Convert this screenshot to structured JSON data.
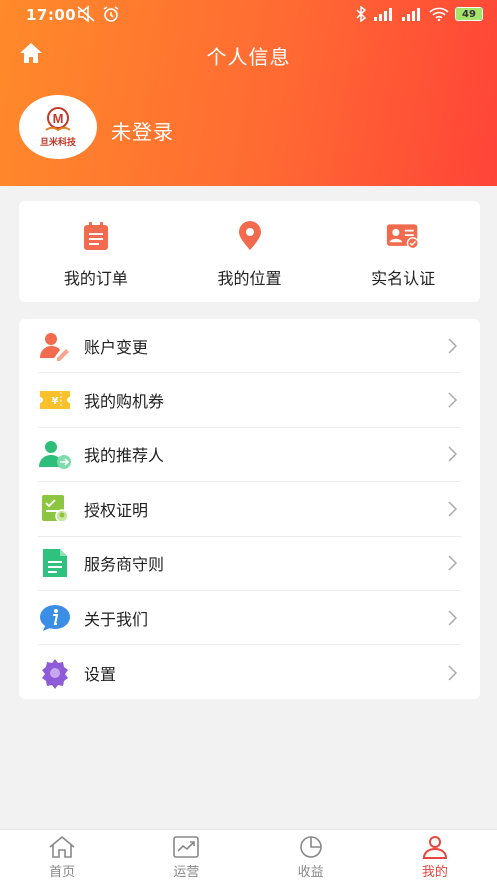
{
  "status": {
    "time": "17:00",
    "battery": "49"
  },
  "header": {
    "title": "个人信息"
  },
  "profile": {
    "login_text": "未登录",
    "logo_text": "旦米科技"
  },
  "quick": [
    {
      "label": "我的订单",
      "icon": "order-icon"
    },
    {
      "label": "我的位置",
      "icon": "location-icon"
    },
    {
      "label": "实名认证",
      "icon": "id-card-icon"
    }
  ],
  "menu": [
    {
      "label": "账户变更",
      "icon": "user-edit-icon"
    },
    {
      "label": "我的购机券",
      "icon": "coupon-icon"
    },
    {
      "label": "我的推荐人",
      "icon": "referrer-icon"
    },
    {
      "label": "授权证明",
      "icon": "certificate-icon"
    },
    {
      "label": "服务商守则",
      "icon": "document-icon"
    },
    {
      "label": "关于我们",
      "icon": "info-icon"
    },
    {
      "label": "设置",
      "icon": "settings-icon"
    }
  ],
  "tabs": [
    {
      "label": "首页",
      "icon": "home-icon"
    },
    {
      "label": "运营",
      "icon": "chart-icon"
    },
    {
      "label": "收益",
      "icon": "pie-icon"
    },
    {
      "label": "我的",
      "icon": "person-icon"
    }
  ],
  "colors": {
    "accent": "#e8453c",
    "header_start": "#ff8a2a",
    "header_end": "#ff4438"
  }
}
